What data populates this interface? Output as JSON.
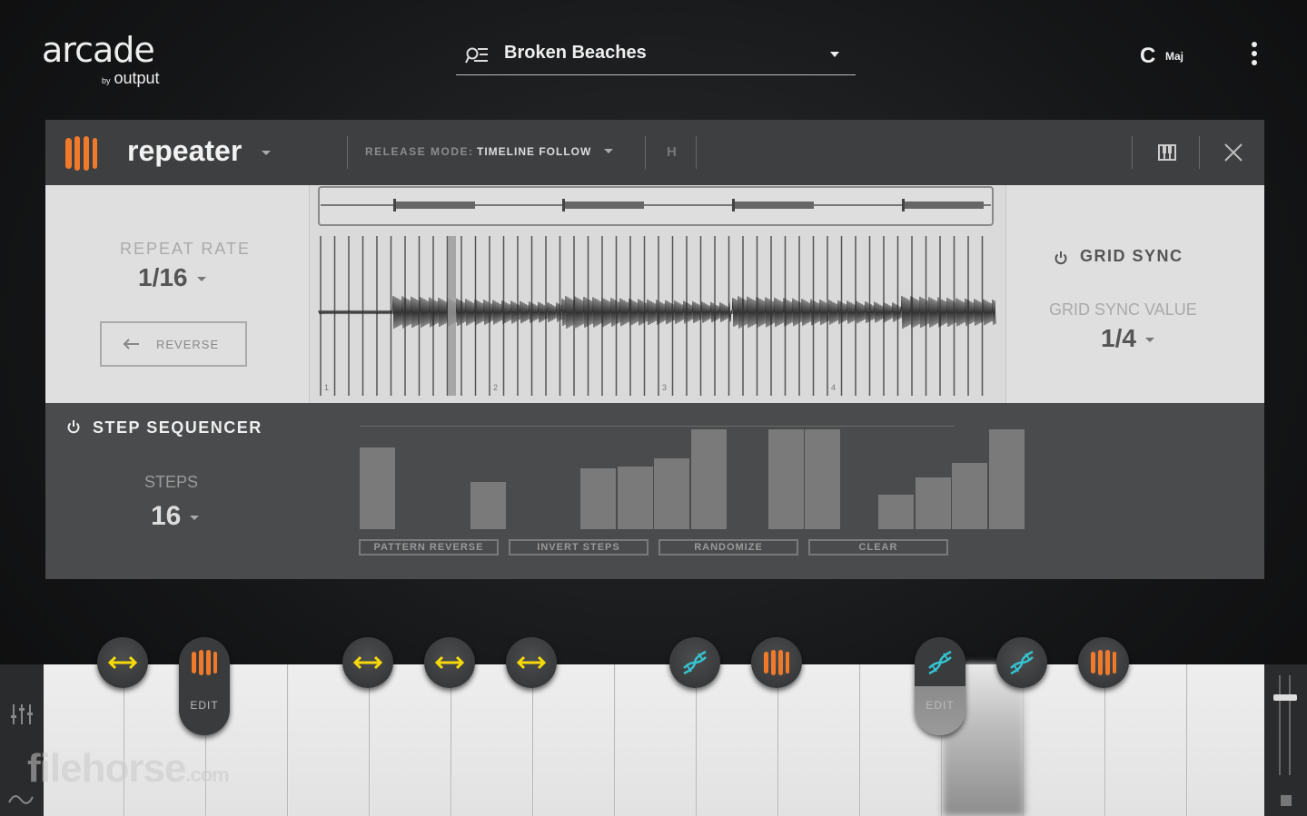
{
  "app": {
    "logo": "arcade",
    "logo_by": "by",
    "logo_brand": "output"
  },
  "preset": {
    "name": "Broken Beaches"
  },
  "key": {
    "note": "C",
    "mode": "Maj"
  },
  "effect": {
    "name": "repeater",
    "release_mode_label": "RELEASE MODE:",
    "release_mode_value": "TIMELINE FOLLOW",
    "h_label": "H"
  },
  "repeat": {
    "label": "REPEAT RATE",
    "value": "1/16",
    "reverse_label": "REVERSE"
  },
  "waveform": {
    "bar_numbers": [
      "1",
      "2",
      "3",
      "4"
    ]
  },
  "grid_sync": {
    "label": "GRID SYNC",
    "value_label": "GRID SYNC VALUE",
    "value": "1/4"
  },
  "sequencer": {
    "title": "STEP SEQUENCER",
    "steps_label": "STEPS",
    "steps_value": "16",
    "step_levels": [
      0.82,
      0,
      0.47,
      0,
      0,
      0.61,
      0.63,
      0.71,
      1.0,
      0,
      1.0,
      1.0,
      0,
      0.35,
      0.52,
      0.66,
      1.0
    ],
    "buttons": [
      "PATTERN REVERSE",
      "INVERT STEPS",
      "RANDOMIZE",
      "CLEAR"
    ]
  },
  "keyboard": {
    "edit_label": "EDIT",
    "modifiers": [
      "arrows-icon",
      "repeater-icon",
      "arrows-icon",
      "arrows-icon",
      "arrows-icon",
      "dna-icon",
      "repeater-icon",
      "dna-icon",
      "dna-icon",
      "repeater-icon"
    ]
  },
  "watermark": {
    "text": "filehorse",
    "suffix": ".com"
  },
  "colors": {
    "accent_orange": "#f07a2a",
    "accent_yellow": "#f5d90a",
    "accent_cyan": "#35c3d0"
  }
}
